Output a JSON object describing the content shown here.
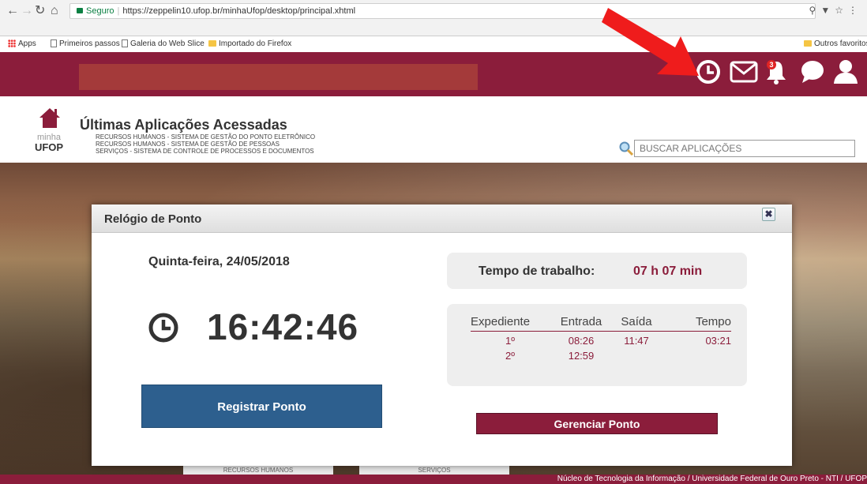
{
  "browser": {
    "security": "Seguro",
    "url": "https://zeppelin10.ufop.br/minhaUfop/desktop/principal.xhtml",
    "bookmarks": [
      "Apps",
      "Primeiros passos",
      "Galeria do Web Slice",
      "Importado do Firefox"
    ],
    "other_bookmarks": "Outros favoritos"
  },
  "header": {
    "notifications_badge": "3",
    "icons": [
      "clock-icon",
      "mail-icon",
      "bell-icon",
      "chat-icon",
      "user-icon"
    ],
    "brand_color": "#8b1d3b"
  },
  "logo": {
    "line1": "minha",
    "line2": "UFOP"
  },
  "recent_apps": {
    "title": "Últimas Aplicações Acessadas",
    "items": [
      "RECURSOS HUMANOS - SISTEMA DE GESTÃO DO PONTO ELETRÔNICO",
      "RECURSOS HUMANOS - SISTEMA DE GESTÃO DE PESSOAS",
      "SERVIÇOS - SISTEMA DE CONTROLE DE PROCESSOS E DOCUMENTOS"
    ]
  },
  "search": {
    "placeholder": "BUSCAR APLICAÇÕES"
  },
  "bottom_tabs": [
    "RECURSOS HUMANOS",
    "SERVIÇOS"
  ],
  "footer": "Núcleo de Tecnologia da Informação / Universidade Federal de Ouro Preto - NTI / UFOP",
  "modal": {
    "title": "Relógio de Ponto",
    "date": "Quinta-feira, 24/05/2018",
    "time": "16:42:46",
    "register_button": "Registrar Ponto",
    "manage_button": "Gerenciar Ponto",
    "work_time_label": "Tempo de trabalho:",
    "work_time_value": "07 h 07 min",
    "table": {
      "headers": [
        "Expediente",
        "Entrada",
        "Saída",
        "Tempo"
      ],
      "rows": [
        {
          "expediente": "1º",
          "entrada": "08:26",
          "saida": "11:47",
          "tempo": "03:21"
        },
        {
          "expediente": "2º",
          "entrada": "12:59",
          "saida": "",
          "tempo": ""
        }
      ]
    }
  }
}
